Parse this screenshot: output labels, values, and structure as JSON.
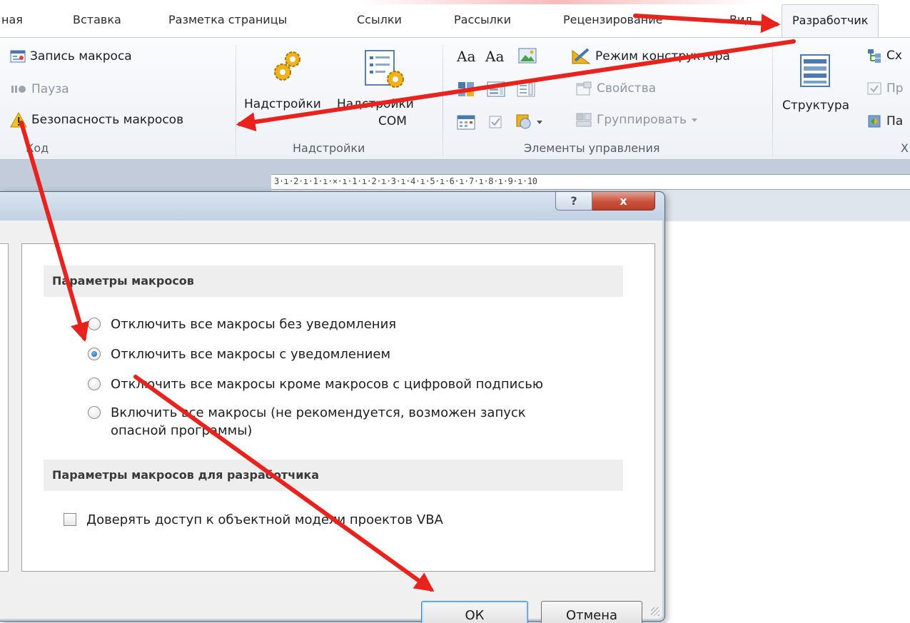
{
  "ribbon": {
    "tabs": [
      {
        "label": "ная"
      },
      {
        "label": "Вставка"
      },
      {
        "label": "Разметка страницы"
      },
      {
        "label": "Ссылки"
      },
      {
        "label": "Рассылки"
      },
      {
        "label": "Рецензирование"
      },
      {
        "label": "Вид"
      },
      {
        "label": "Разработчик"
      }
    ],
    "active_tab": "Разработчик",
    "groups": {
      "code": {
        "label": "Код",
        "record_macro": "Запись макроса",
        "pause": "Пауза",
        "macro_security": "Безопасность макросов"
      },
      "addins": {
        "label": "Надстройки",
        "addins_button": "Надстройки",
        "com_addins_line1": "Надстройки",
        "com_addins_line2": "COM"
      },
      "controls": {
        "label": "Элементы управления",
        "design_mode": "Режим конструктора",
        "properties": "Свойства",
        "group": "Группировать",
        "text_glyph_1": "Aa",
        "text_glyph_2": "Aa"
      },
      "xml": {
        "label": "Х",
        "structure": "Структура",
        "item_1": "Сх",
        "item_2": "Пр",
        "item_3": "Па"
      }
    }
  },
  "ruler": {
    "text": "3·ı·2·ı·1·ı·⨯·ı·1·ı·2·ı·3·ı·4·ı·5·ı·6·ı·7·ı·8·ı·9·ı·10"
  },
  "dialog": {
    "help_glyph": "?",
    "close_glyph": "x",
    "macro_section": "Параметры макросов",
    "options": [
      {
        "label": "Отключить все макросы без уведомления",
        "selected": false
      },
      {
        "label": "Отключить все макросы с уведомлением",
        "selected": true
      },
      {
        "label": "Отключить все макросы кроме макросов с цифровой подписью",
        "selected": false
      },
      {
        "label": "Включить все макросы (не рекомендуется, возможен запуск",
        "label_line2": "опасной программы)",
        "selected": false
      }
    ],
    "developer_section": "Параметры макросов для разработчика",
    "trust_vba": "Доверять доступ к объектной модели проектов VBA",
    "trust_vba_checked": false,
    "ok": "ОК",
    "cancel": "Отмена"
  },
  "colors": {
    "annotation_arrow": "#e8231d",
    "radio_selected": "#1d5f9c",
    "close_button": "#c9503b"
  }
}
